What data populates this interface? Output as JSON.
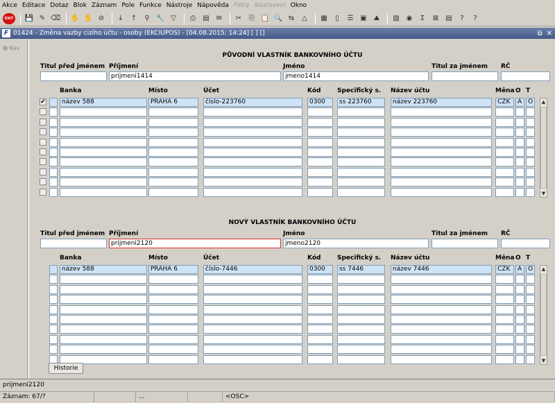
{
  "menu": [
    {
      "label": "Akce",
      "enabled": true
    },
    {
      "label": "Editace",
      "enabled": true
    },
    {
      "label": "Dotaz",
      "enabled": true
    },
    {
      "label": "Blok",
      "enabled": true
    },
    {
      "label": "Záznam",
      "enabled": true
    },
    {
      "label": "Pole",
      "enabled": true
    },
    {
      "label": "Funkce",
      "enabled": true
    },
    {
      "label": "Nástroje",
      "enabled": true
    },
    {
      "label": "Nápověda",
      "enabled": true
    },
    {
      "label": "Filtry",
      "enabled": false
    },
    {
      "label": "Nastavení",
      "enabled": false
    },
    {
      "label": "Okno",
      "enabled": true
    }
  ],
  "toolbar": {
    "exit_label": "EXIT",
    "icons": [
      {
        "name": "save-icon",
        "glyph": "💾"
      },
      {
        "name": "edit-icon",
        "glyph": "✎"
      },
      {
        "name": "clear-icon",
        "glyph": "⌫"
      },
      {
        "sep": true
      },
      {
        "name": "query-enter-icon",
        "glyph": "✋"
      },
      {
        "name": "query-execute-icon",
        "glyph": "✋"
      },
      {
        "name": "query-cancel-icon",
        "glyph": "⊘"
      },
      {
        "sep": true
      },
      {
        "name": "sort-asc-icon",
        "glyph": "↓"
      },
      {
        "name": "sort-desc-icon",
        "glyph": "↑"
      },
      {
        "name": "filter-icon",
        "glyph": "⚲"
      },
      {
        "name": "wrench-icon",
        "glyph": "🔧"
      },
      {
        "name": "funnel-icon",
        "glyph": "▽"
      },
      {
        "sep": true
      },
      {
        "name": "print-icon",
        "glyph": "⎙"
      },
      {
        "name": "preview-icon",
        "glyph": "▤"
      },
      {
        "name": "mail-icon",
        "glyph": "✉"
      },
      {
        "sep": true
      },
      {
        "name": "cut-icon",
        "glyph": "✂"
      },
      {
        "name": "copy-icon",
        "glyph": "⎘"
      },
      {
        "name": "paste-icon",
        "glyph": "📋"
      },
      {
        "name": "find-icon",
        "glyph": "🔍"
      },
      {
        "name": "replace-icon",
        "glyph": "⇆"
      },
      {
        "name": "calc-icon",
        "glyph": "△"
      },
      {
        "sep": true
      },
      {
        "name": "calendar-icon",
        "glyph": "▦"
      },
      {
        "name": "doc-icon",
        "glyph": "▯"
      },
      {
        "name": "list-icon",
        "glyph": "☰"
      },
      {
        "name": "image-icon",
        "glyph": "▣"
      },
      {
        "name": "chart-icon",
        "glyph": "⛰"
      },
      {
        "sep": true
      },
      {
        "name": "report-icon",
        "glyph": "▧"
      },
      {
        "name": "stamp-icon",
        "glyph": "◉"
      },
      {
        "name": "sum-icon",
        "glyph": "Σ"
      },
      {
        "name": "excel-icon",
        "glyph": "⊠"
      },
      {
        "name": "export-icon",
        "glyph": "▤"
      },
      {
        "name": "help-icon",
        "glyph": "?"
      },
      {
        "name": "context-help-icon",
        "glyph": "?"
      }
    ]
  },
  "window": {
    "title": "01424 - Změna vazby cizího účtu - osoby (EKCIUPOS) - [04.08.2015; 14:24] [ ] []",
    "restore_glyph": "⧉",
    "close_glyph": "✕"
  },
  "nav": {
    "label": "Nav"
  },
  "original_owner": {
    "section_title": "PŮVODNÍ VLASTNÍK BANKOVNÍHO ÚČTU",
    "labels": {
      "title_before": "Titul před jménem",
      "surname": "Příjmení",
      "firstname": "Jméno",
      "title_after": "Titul za jménem",
      "rc": "RČ"
    },
    "values": {
      "title_before": "",
      "surname": "prijmeni1414",
      "firstname": "jmeno1414",
      "title_after": "",
      "rc": ""
    },
    "columns": {
      "bank": "Banka",
      "place": "Místo",
      "account": "Účet",
      "code": "Kód",
      "specific": "Specifický s.",
      "account_name": "Název účtu",
      "currency": "Měna",
      "o": "O",
      "t": "T"
    },
    "rows": [
      {
        "checked": true,
        "bank": "název 588",
        "place": "PRAHA 6",
        "account": "číslo-223760",
        "code": "0300",
        "specific": "ss 223760",
        "account_name": "název 223760",
        "currency": "CZK",
        "o": "A",
        "t": "O"
      },
      {
        "checked": false,
        "bank": "",
        "place": "",
        "account": "",
        "code": "",
        "specific": "",
        "account_name": "",
        "currency": "",
        "o": "",
        "t": ""
      },
      {
        "checked": false,
        "bank": "",
        "place": "",
        "account": "",
        "code": "",
        "specific": "",
        "account_name": "",
        "currency": "",
        "o": "",
        "t": ""
      },
      {
        "checked": false,
        "bank": "",
        "place": "",
        "account": "",
        "code": "",
        "specific": "",
        "account_name": "",
        "currency": "",
        "o": "",
        "t": ""
      },
      {
        "checked": false,
        "bank": "",
        "place": "",
        "account": "",
        "code": "",
        "specific": "",
        "account_name": "",
        "currency": "",
        "o": "",
        "t": ""
      },
      {
        "checked": false,
        "bank": "",
        "place": "",
        "account": "",
        "code": "",
        "specific": "",
        "account_name": "",
        "currency": "",
        "o": "",
        "t": ""
      },
      {
        "checked": false,
        "bank": "",
        "place": "",
        "account": "",
        "code": "",
        "specific": "",
        "account_name": "",
        "currency": "",
        "o": "",
        "t": ""
      },
      {
        "checked": false,
        "bank": "",
        "place": "",
        "account": "",
        "code": "",
        "specific": "",
        "account_name": "",
        "currency": "",
        "o": "",
        "t": ""
      },
      {
        "checked": false,
        "bank": "",
        "place": "",
        "account": "",
        "code": "",
        "specific": "",
        "account_name": "",
        "currency": "",
        "o": "",
        "t": ""
      },
      {
        "checked": false,
        "bank": "",
        "place": "",
        "account": "",
        "code": "",
        "specific": "",
        "account_name": "",
        "currency": "",
        "o": "",
        "t": ""
      }
    ]
  },
  "new_owner": {
    "section_title": "NOVÝ VLASTNÍK BANKOVNÍHO ÚČTU",
    "labels": {
      "title_before": "Titul před jménem",
      "surname": "Příjmení",
      "firstname": "Jméno",
      "title_after": "Titul za jménem",
      "rc": "RČ"
    },
    "values": {
      "title_before": "",
      "surname": "prijmeni2120",
      "firstname": "jmeno2120",
      "title_after": "",
      "rc": ""
    },
    "columns": {
      "bank": "Banka",
      "place": "Místo",
      "account": "Účet",
      "code": "Kód",
      "specific": "Specifický s.",
      "account_name": "Název účtu",
      "currency": "Měna",
      "o": "O",
      "t": "T"
    },
    "rows": [
      {
        "bank": "název 588",
        "place": "PRAHA 6",
        "account": "číslo-7446",
        "code": "0300",
        "specific": "ss 7446",
        "account_name": "název 7446",
        "currency": "CZK",
        "o": "A",
        "t": "O"
      },
      {
        "bank": "",
        "place": "",
        "account": "",
        "code": "",
        "specific": "",
        "account_name": "",
        "currency": "",
        "o": "",
        "t": ""
      },
      {
        "bank": "",
        "place": "",
        "account": "",
        "code": "",
        "specific": "",
        "account_name": "",
        "currency": "",
        "o": "",
        "t": ""
      },
      {
        "bank": "",
        "place": "",
        "account": "",
        "code": "",
        "specific": "",
        "account_name": "",
        "currency": "",
        "o": "",
        "t": ""
      },
      {
        "bank": "",
        "place": "",
        "account": "",
        "code": "",
        "specific": "",
        "account_name": "",
        "currency": "",
        "o": "",
        "t": ""
      },
      {
        "bank": "",
        "place": "",
        "account": "",
        "code": "",
        "specific": "",
        "account_name": "",
        "currency": "",
        "o": "",
        "t": ""
      },
      {
        "bank": "",
        "place": "",
        "account": "",
        "code": "",
        "specific": "",
        "account_name": "",
        "currency": "",
        "o": "",
        "t": ""
      },
      {
        "bank": "",
        "place": "",
        "account": "",
        "code": "",
        "specific": "",
        "account_name": "",
        "currency": "",
        "o": "",
        "t": ""
      },
      {
        "bank": "",
        "place": "",
        "account": "",
        "code": "",
        "specific": "",
        "account_name": "",
        "currency": "",
        "o": "",
        "t": ""
      },
      {
        "bank": "",
        "place": "",
        "account": "",
        "code": "",
        "specific": "",
        "account_name": "",
        "currency": "",
        "o": "",
        "t": ""
      }
    ]
  },
  "history_button": "Historie",
  "status": {
    "message": "prijmeni2120",
    "record": "Záznam: 67/?",
    "cell2": "",
    "cell3": "...",
    "cell4": "",
    "mode": "<OSC>"
  },
  "colors": {
    "selected_row": "#cfe3f7",
    "title_bar": "#42598a",
    "active_field_border": "#e03030"
  }
}
